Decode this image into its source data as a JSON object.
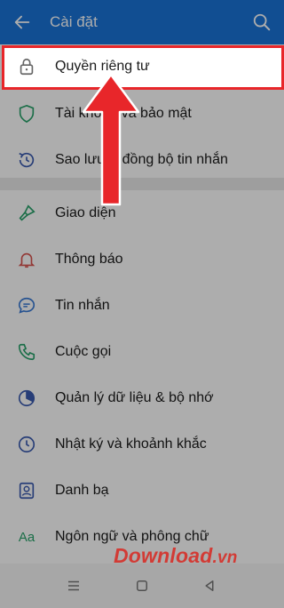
{
  "header": {
    "title": "Cài đặt",
    "back_icon": "arrow-left-icon",
    "search_icon": "search-icon",
    "background": "#1a73d8"
  },
  "settings": {
    "items": [
      {
        "label": "Quyền riêng tư",
        "icon": "lock-icon",
        "highlighted": true
      },
      {
        "label": "Tài khoản và bảo mật",
        "icon": "shield-icon"
      },
      {
        "label": "Sao lưu & đồng bộ tin nhắn",
        "icon": "backup-clock-icon"
      },
      {
        "label": "Giao diện",
        "icon": "paint-brush-icon"
      },
      {
        "label": "Thông báo",
        "icon": "bell-icon"
      },
      {
        "label": "Tin nhắn",
        "icon": "chat-bubble-icon"
      },
      {
        "label": "Cuộc gọi",
        "icon": "phone-icon"
      },
      {
        "label": "Quản lý dữ liệu & bộ nhớ",
        "icon": "pie-chart-icon"
      },
      {
        "label": "Nhật ký và khoảnh khắc",
        "icon": "clock-icon"
      },
      {
        "label": "Danh bạ",
        "icon": "contacts-icon"
      },
      {
        "label": "Ngôn ngữ và phông chữ",
        "icon": "language-aa-icon",
        "icon_text": "Aa"
      }
    ]
  },
  "annotation": {
    "highlight_color": "#e8262a",
    "arrow_direction": "up"
  },
  "watermark": {
    "main": "Download",
    "tld": ".vn"
  },
  "bottom_nav": {
    "menu_icon": "menu-lines-icon",
    "home_icon": "home-square-icon",
    "back_icon": "back-triangle-icon"
  }
}
